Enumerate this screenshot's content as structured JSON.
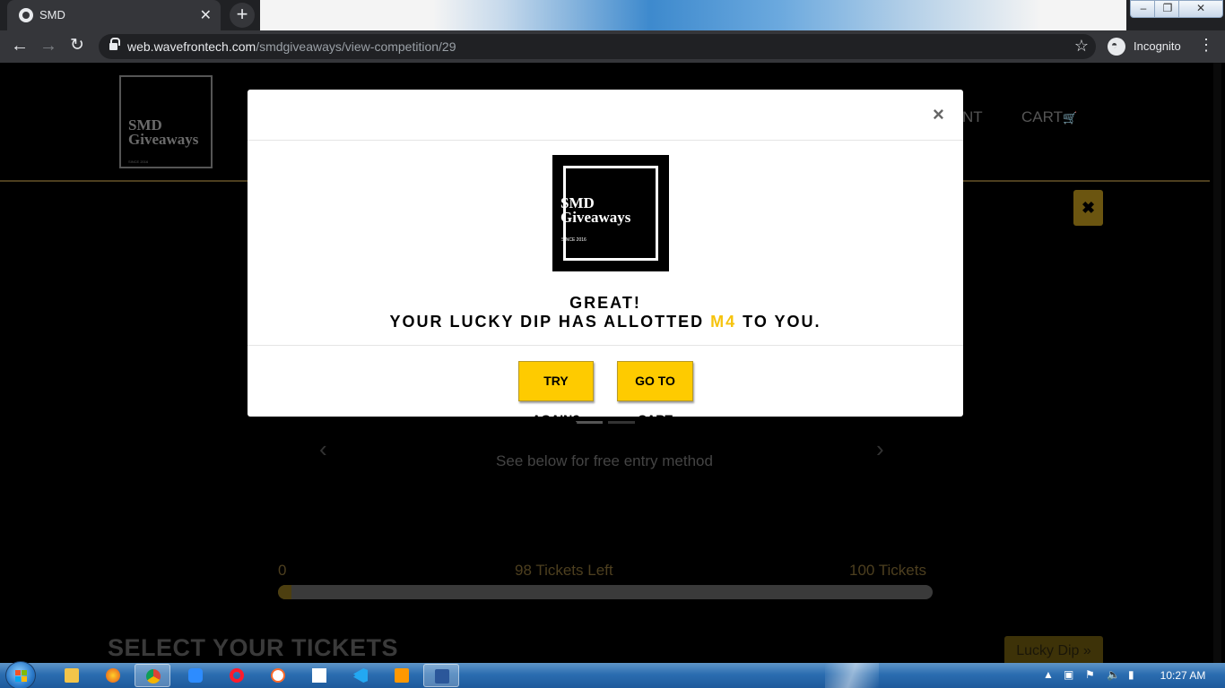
{
  "browser": {
    "tab_title": "SMD",
    "url_host": "web.wavefrontech.com",
    "url_path": "/smdgiveaways/view-competition/29",
    "profile_label": "Incognito"
  },
  "site": {
    "logo_text_line1": "SMD",
    "logo_text_line2": "Giveaways",
    "logo_since": "SINCE 2016",
    "nav_partial": "NT",
    "nav_cart": "CART",
    "carousel_caption": "See below for free entry method",
    "progress": {
      "min_label": "0",
      "left_label": "98 Tickets Left",
      "max_label": "100 Tickets",
      "fraction": 0.02
    },
    "section_title": "SELECT YOUR TICKETS",
    "lucky_dip_label": "Lucky Dip »"
  },
  "modal": {
    "close_label": "×",
    "heading": "GREAT!",
    "message_prefix": "YOUR LUCKY DIP HAS ALLOTTED ",
    "allotted_ticket": "M4",
    "message_suffix": " TO YOU.",
    "try_again_label": "TRY AGAIN?",
    "go_to_cart_label": "GO TO CART",
    "highlight_color": "#f6c30d",
    "button_color": "#fecb00"
  },
  "taskbar": {
    "clock": "10:27 AM"
  }
}
